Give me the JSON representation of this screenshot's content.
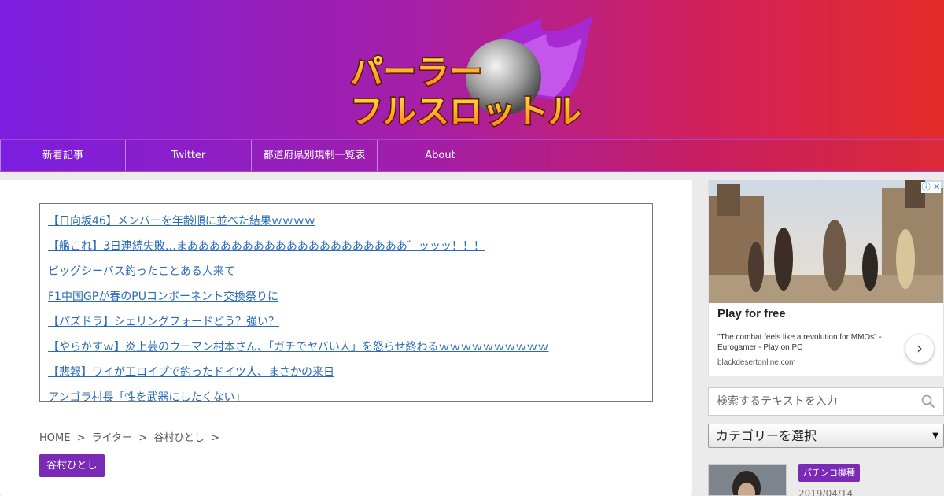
{
  "header": {
    "logo_line1": "パーラー",
    "logo_line2": "フルスロットル"
  },
  "nav": {
    "items": [
      {
        "label": "新着記事"
      },
      {
        "label": "Twitter"
      },
      {
        "label": "都道府県別規制一覧表"
      },
      {
        "label": "About"
      }
    ]
  },
  "rss": {
    "links": [
      "【日向坂46】メンバーを年齢順に並べた結果ｗｗｗｗ",
      "【艦これ】3日連続失敗…まああああああああああああああああああああ゛ッッッ！！！",
      "ビッグシーバス釣ったことある人来て",
      "F1中国GPが春のPUコンポーネント交換祭りに",
      "【パズドラ】シェリングフォードどう？強い？",
      "【やらかすｗ】炎上芸のウーマン村本さん、「ガチでヤバい人」を怒らせ終わるｗｗｗｗｗｗｗｗｗｗ",
      "【悲報】ワイが工ロイプで釣ったドイツ人、まさかの来日",
      "アンゴラ村長「性を武器にしたくない」"
    ]
  },
  "breadcrumb": {
    "home": "HOME",
    "sep": ">",
    "writer": "ライター",
    "name": "谷村ひとし"
  },
  "author_tag": "谷村ひとし",
  "ad": {
    "title": "Play for free",
    "quote": "\"The combat feels like a revolution for MMOs\" - Eurogamer - Play on PC",
    "domain": "blackdesertonline.com",
    "info_icon": "info-icon",
    "close_icon": "close-icon",
    "arrow_icon": "chevron-right-icon"
  },
  "search": {
    "placeholder": "検索するテキストを入力"
  },
  "category_select": {
    "selected": "カテゴリーを選択"
  },
  "post": {
    "category": "パチンコ機種",
    "date": "2019/04/14"
  },
  "colors": {
    "accent": "#7a2bb5",
    "link": "#2a6bb8",
    "header_left": "#7b1fe0",
    "header_right": "#e52c2a"
  }
}
